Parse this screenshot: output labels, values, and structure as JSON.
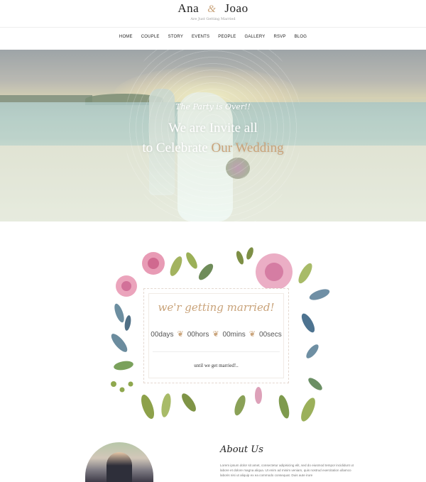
{
  "header": {
    "brand_left": "Ana",
    "brand_amp": "&",
    "brand_right": "Joao",
    "tagline": "Are Just Getting Married"
  },
  "nav": {
    "items": [
      "HOME",
      "COUPLE",
      "STORY",
      "EVENTS",
      "PEOPLE",
      "GALLERY",
      "RSVP",
      "BLOG"
    ]
  },
  "hero": {
    "script": "The Party is Over!!",
    "line1": "We are Invite all",
    "line2_prefix": "to Celebrate ",
    "line2_accent": "Our Wedding"
  },
  "countdown": {
    "title": "we'r getting married!",
    "days": "00days",
    "hours": "00hors",
    "mins": "00mins",
    "secs": "00secs",
    "separator": "❦",
    "until": "until we get married!.."
  },
  "about": {
    "title": "About Us",
    "text": "Lorem ipsum dolor sit amet, consectetur adipisicing elit, sed do eiusmod tempor incididunt ut labore et dolore magna aliqua. Ut enim ad minim veniam, quis nostrud exercitation ullamco laboris nisi ut aliquip ex ea commodo consequat. Duis aute irure"
  },
  "colors": {
    "accent": "#c9a37a",
    "text": "#333333"
  }
}
